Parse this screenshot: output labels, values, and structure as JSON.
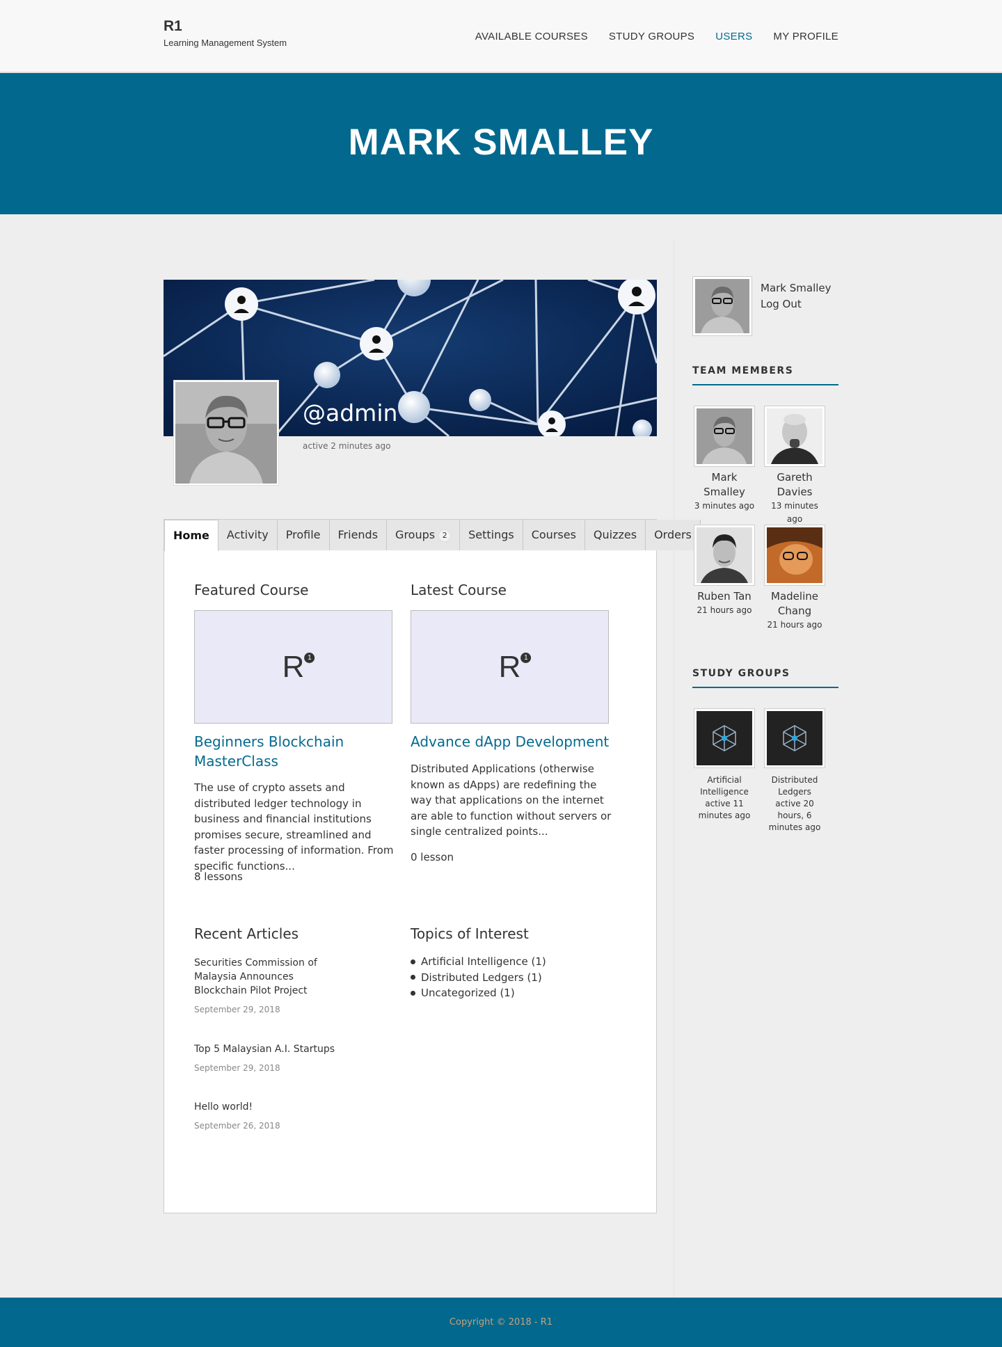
{
  "brand": {
    "title": "R1",
    "subtitle": "Learning Management System"
  },
  "nav": [
    {
      "label": "AVAILABLE COURSES"
    },
    {
      "label": "STUDY GROUPS"
    },
    {
      "label": "USERS"
    },
    {
      "label": "MY PROFILE"
    }
  ],
  "hero": {
    "title": "MARK SMALLEY"
  },
  "profile": {
    "username": "@admin",
    "last_active": "active 2 minutes ago"
  },
  "tabs": [
    {
      "label": "Home"
    },
    {
      "label": "Activity"
    },
    {
      "label": "Profile"
    },
    {
      "label": "Friends"
    },
    {
      "label": "Groups",
      "count": "2"
    },
    {
      "label": "Settings"
    },
    {
      "label": "Courses"
    },
    {
      "label": "Quizzes"
    },
    {
      "label": "Orders"
    }
  ],
  "featured": {
    "heading": "Featured Course",
    "logo": "R",
    "logo_sup": "1",
    "title": "Beginners Blockchain MasterClass",
    "description": "The use of crypto assets and distributed ledger technology in business and financial institutions promises secure, streamlined and faster processing of information. From specific functions...",
    "meta": "8 lessons"
  },
  "latest": {
    "heading": "Latest Course",
    "logo": "R",
    "logo_sup": "1",
    "title": "Advance dApp Development",
    "description": "Distributed Applications (otherwise known as dApps) are redefining the way that applications on the internet are able to function without servers or single centralized points...",
    "meta": "0 lesson"
  },
  "articles": {
    "heading": "Recent Articles",
    "items": [
      {
        "title": "Securities Commission of Malaysia Announces Blockchain Pilot Project",
        "date": "September 29, 2018"
      },
      {
        "title": "Top 5 Malaysian A.I. Startups",
        "date": "September 29, 2018"
      },
      {
        "title": "Hello world!",
        "date": "September 26, 2018"
      }
    ]
  },
  "topics": {
    "heading": "Topics of Interest",
    "items": [
      {
        "label": "Artificial Intelligence (1)"
      },
      {
        "label": "Distributed Ledgers (1)"
      },
      {
        "label": "Uncategorized (1)"
      }
    ]
  },
  "sidebar": {
    "user_name": "Mark Smalley",
    "logout": "Log Out",
    "team_heading": "TEAM MEMBERS",
    "members": [
      {
        "name": "Mark Smalley",
        "time": "3 minutes ago"
      },
      {
        "name": "Gareth Davies",
        "time": "13 minutes ago"
      },
      {
        "name": "Ruben Tan",
        "time": "21 hours ago"
      },
      {
        "name": "Madeline Chang",
        "time": "21 hours ago"
      }
    ],
    "groups_heading": "STUDY GROUPS",
    "groups": [
      {
        "name": "Artificial Intelligence",
        "activity": "active 11 minutes ago"
      },
      {
        "name": "Distributed Ledgers",
        "activity": "active 20 hours, 6 minutes ago"
      }
    ]
  },
  "footer": {
    "copyright": "Copyright © 2018 - R1"
  },
  "colors": {
    "primary": "#02688e",
    "link": "#036a8e",
    "page_bg": "#eeeeee",
    "cover_bg": "#0a2a57"
  }
}
